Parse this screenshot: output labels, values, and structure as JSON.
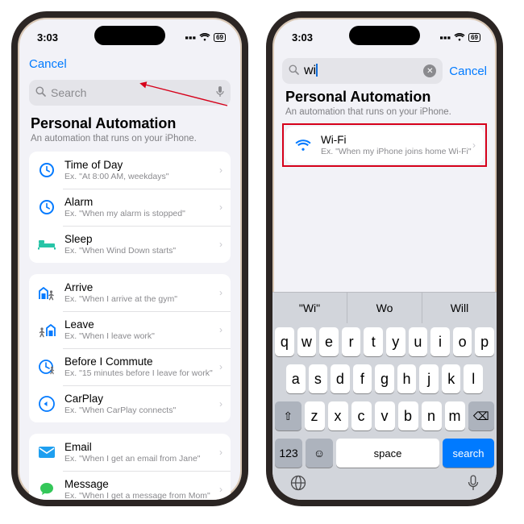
{
  "status": {
    "time": "3:03",
    "battery": "69"
  },
  "page": {
    "title": "Personal Automation",
    "subtitle": "An automation that runs on your iPhone."
  },
  "left": {
    "cancel": "Cancel",
    "search_placeholder": "Search",
    "groups": [
      {
        "rows": [
          {
            "title": "Time of Day",
            "sub": "Ex. \"At 8:00 AM, weekdays\"",
            "icon": "clock"
          },
          {
            "title": "Alarm",
            "sub": "Ex. \"When my alarm is stopped\"",
            "icon": "clock"
          },
          {
            "title": "Sleep",
            "sub": "Ex. \"When Wind Down starts\"",
            "icon": "bed"
          }
        ]
      },
      {
        "rows": [
          {
            "title": "Arrive",
            "sub": "Ex. \"When I arrive at the gym\"",
            "icon": "arrive"
          },
          {
            "title": "Leave",
            "sub": "Ex. \"When I leave work\"",
            "icon": "leave"
          },
          {
            "title": "Before I Commute",
            "sub": "Ex. \"15 minutes before I leave for work\"",
            "icon": "commute"
          },
          {
            "title": "CarPlay",
            "sub": "Ex. \"When CarPlay connects\"",
            "icon": "carplay"
          }
        ]
      },
      {
        "rows": [
          {
            "title": "Email",
            "sub": "Ex. \"When I get an email from Jane\"",
            "icon": "email"
          },
          {
            "title": "Message",
            "sub": "Ex. \"When I get a message from Mom\"",
            "icon": "message"
          }
        ]
      }
    ]
  },
  "right": {
    "cancel": "Cancel",
    "search_value": "wi",
    "result": {
      "title": "Wi-Fi",
      "sub": "Ex. \"When my iPhone joins home Wi-Fi\""
    },
    "suggestions": [
      "\"Wi\"",
      "Wo",
      "Will"
    ],
    "keys_r1": [
      "q",
      "w",
      "e",
      "r",
      "t",
      "y",
      "u",
      "i",
      "o",
      "p"
    ],
    "keys_r2": [
      "a",
      "s",
      "d",
      "f",
      "g",
      "h",
      "j",
      "k",
      "l"
    ],
    "keys_r3": [
      "z",
      "x",
      "c",
      "v",
      "b",
      "n",
      "m"
    ],
    "fn": {
      "num": "123",
      "space": "space",
      "search": "search"
    }
  }
}
